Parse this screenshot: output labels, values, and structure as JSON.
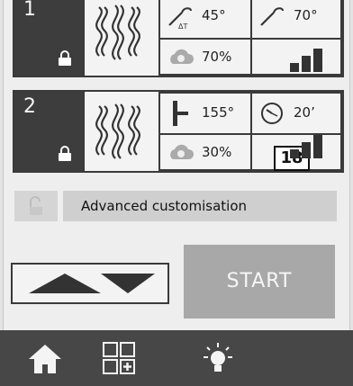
{
  "programs": [
    {
      "number": "1",
      "values": [
        "45°",
        "70°",
        "70%"
      ],
      "cell_icons": [
        "probe-delta-t-icon",
        "probe-icon",
        "humidity-cloud-icon"
      ],
      "power_level": 3
    },
    {
      "number": "2",
      "values": [
        "155°",
        "20’",
        "30%"
      ],
      "cell_icons": [
        "thermometer-icon",
        "timer-icon",
        "humidity-cloud-icon"
      ],
      "power_level": 3,
      "badge": "18"
    }
  ],
  "advanced": {
    "label": "Advanced customisation"
  },
  "controls": {
    "start_label": "START"
  },
  "navbar": {
    "items": [
      "home-icon",
      "add-program-grid-icon",
      "light-icon"
    ]
  },
  "colors": {
    "dark": "#3d3d3d",
    "start_bg": "#a8a8a8",
    "navbar_bg": "#474747"
  }
}
